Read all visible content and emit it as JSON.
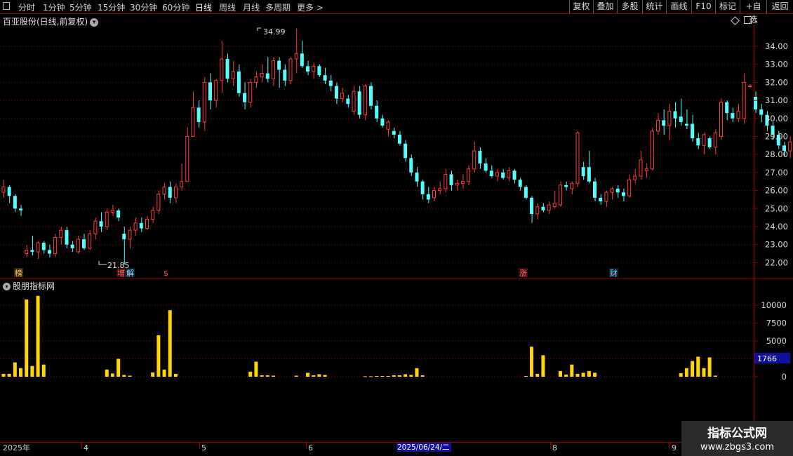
{
  "toolbar": {
    "periods": [
      "分时",
      "1分钟",
      "5分钟",
      "15分钟",
      "30分钟",
      "60分钟",
      "日线",
      "周线",
      "月线",
      "多周期",
      "更多"
    ],
    "selected": "日线",
    "right_buttons": [
      "复权",
      "叠加",
      "多股",
      "统计",
      "画线",
      "F10",
      "标记",
      "+自选",
      "返回"
    ]
  },
  "chart_title": "百亚股份(日线,前复权)",
  "indicator_title": "股朋指标网",
  "price_axis": [
    "34.00",
    "33.00",
    "32.00",
    "31.00",
    "30.00",
    "29.00",
    "28.00",
    "27.00",
    "26.00",
    "25.00",
    "24.00",
    "23.00",
    "22.00"
  ],
  "volume_axis": [
    "10000",
    "7500",
    "5000",
    "2500",
    "0"
  ],
  "volume_current": "1766",
  "high_label": "34.99",
  "low_label": "21.85",
  "events": [
    "榜",
    "增",
    "解",
    "$",
    "涨",
    "财"
  ],
  "x_axis": [
    "2025年",
    "4",
    "5",
    "6",
    "2025/06/24/二",
    "8",
    "9"
  ],
  "watermark": {
    "line1": "指标公式网",
    "line2": "www.zbgs3.com"
  },
  "colors": {
    "up": "#ff3c3c",
    "down": "#54ffff",
    "volume": "#ffd700",
    "grid": "#8a0000",
    "axis_text": "#d8d8d8"
  },
  "chart_data": {
    "type": "candlestick",
    "symbol": "百亚股份",
    "ylim": [
      21.5,
      35.3
    ],
    "volume_ylim": [
      0,
      12500
    ],
    "candles": [
      [
        25.9,
        26.6,
        25.6,
        26.2
      ],
      [
        26.2,
        26.3,
        25.3,
        25.7
      ],
      [
        25.7,
        25.8,
        24.8,
        25.0
      ],
      [
        25.0,
        25.2,
        24.6,
        24.9
      ],
      [
        22.5,
        23.0,
        22.3,
        22.7
      ],
      [
        22.7,
        23.5,
        22.4,
        22.6
      ],
      [
        22.6,
        23.2,
        22.2,
        23.1
      ],
      [
        23.1,
        23.2,
        22.5,
        22.7
      ],
      [
        22.7,
        23.0,
        22.3,
        22.5
      ],
      [
        22.5,
        23.6,
        22.3,
        23.4
      ],
      [
        23.4,
        24.0,
        23.0,
        23.8
      ],
      [
        23.8,
        24.0,
        22.8,
        23.0
      ],
      [
        23.0,
        23.2,
        22.6,
        22.8
      ],
      [
        22.6,
        23.5,
        22.5,
        23.3
      ],
      [
        23.3,
        23.6,
        22.7,
        22.8
      ],
      [
        22.8,
        23.8,
        22.7,
        23.6
      ],
      [
        23.6,
        24.5,
        23.3,
        24.3
      ],
      [
        24.3,
        24.8,
        23.7,
        24.0
      ],
      [
        24.0,
        25.0,
        23.8,
        24.8
      ],
      [
        24.8,
        25.2,
        24.6,
        24.9
      ],
      [
        24.9,
        25.0,
        24.3,
        24.5
      ],
      [
        23.6,
        24.0,
        21.9,
        23.3
      ],
      [
        23.3,
        24.0,
        22.8,
        23.8
      ],
      [
        23.8,
        24.5,
        23.5,
        24.2
      ],
      [
        24.2,
        24.5,
        23.7,
        23.9
      ],
      [
        23.9,
        24.6,
        23.8,
        24.4
      ],
      [
        24.4,
        25.1,
        24.2,
        24.9
      ],
      [
        24.9,
        26.0,
        24.7,
        25.8
      ],
      [
        25.8,
        26.4,
        25.5,
        26.2
      ],
      [
        26.2,
        26.5,
        25.3,
        25.6
      ],
      [
        25.6,
        26.4,
        25.3,
        26.2
      ],
      [
        26.2,
        27.5,
        26.0,
        26.5
      ],
      [
        26.5,
        29.5,
        26.6,
        29.0
      ],
      [
        29.0,
        31.5,
        30.0,
        30.6
      ],
      [
        30.6,
        31.0,
        29.5,
        29.8
      ],
      [
        29.8,
        32.3,
        29.3,
        32.0
      ],
      [
        32.0,
        32.5,
        30.5,
        31.0
      ],
      [
        31.0,
        32.2,
        30.6,
        32.1
      ],
      [
        32.1,
        34.3,
        31.4,
        33.3
      ],
      [
        33.3,
        33.6,
        32.0,
        32.2
      ],
      [
        32.2,
        33.2,
        31.8,
        32.6
      ],
      [
        32.6,
        33.0,
        31.2,
        31.4
      ],
      [
        31.4,
        32.0,
        30.5,
        30.9
      ],
      [
        30.9,
        32.2,
        30.6,
        32.0
      ],
      [
        32.0,
        32.6,
        31.7,
        32.3
      ],
      [
        32.3,
        33.0,
        32.0,
        32.5
      ],
      [
        32.5,
        33.4,
        32.0,
        32.2
      ],
      [
        32.2,
        33.4,
        31.8,
        33.2
      ],
      [
        33.2,
        33.4,
        31.7,
        32.7
      ],
      [
        32.7,
        33.0,
        31.8,
        32.1
      ],
      [
        32.1,
        33.4,
        31.9,
        33.3
      ],
      [
        33.3,
        34.99,
        32.5,
        33.6
      ],
      [
        33.6,
        34.3,
        32.8,
        32.9
      ],
      [
        32.9,
        33.2,
        32.4,
        32.6
      ],
      [
        32.6,
        33.1,
        32.2,
        32.9
      ],
      [
        32.9,
        33.0,
        32.3,
        32.4
      ],
      [
        32.4,
        32.8,
        31.9,
        32.1
      ],
      [
        32.1,
        32.4,
        31.5,
        31.8
      ],
      [
        31.8,
        32.0,
        30.8,
        31.1
      ],
      [
        31.1,
        31.7,
        30.9,
        31.4
      ],
      [
        31.1,
        31.3,
        30.6,
        30.8
      ],
      [
        30.4,
        31.8,
        30.2,
        31.5
      ],
      [
        31.5,
        31.8,
        30.0,
        30.2
      ],
      [
        30.2,
        31.9,
        29.9,
        31.8
      ],
      [
        31.8,
        32.0,
        30.5,
        30.7
      ],
      [
        30.7,
        31.0,
        29.8,
        30.0
      ],
      [
        30.0,
        30.2,
        29.5,
        29.6
      ],
      [
        29.4,
        29.9,
        29.0,
        29.8
      ],
      [
        29.3,
        29.5,
        28.9,
        29.1
      ],
      [
        29.1,
        29.3,
        28.5,
        28.6
      ],
      [
        28.6,
        28.8,
        27.6,
        27.8
      ],
      [
        27.8,
        28.0,
        26.8,
        27.0
      ],
      [
        27.0,
        27.3,
        26.2,
        26.5
      ],
      [
        26.5,
        26.6,
        25.5,
        25.8
      ],
      [
        25.8,
        26.2,
        25.3,
        25.5
      ],
      [
        25.6,
        26.2,
        25.4,
        26.0
      ],
      [
        26.0,
        26.5,
        25.8,
        26.1
      ],
      [
        26.1,
        27.2,
        25.9,
        26.9
      ],
      [
        26.9,
        27.1,
        26.0,
        26.3
      ],
      [
        26.3,
        26.6,
        26.0,
        26.4
      ],
      [
        26.4,
        26.9,
        26.1,
        26.5
      ],
      [
        26.5,
        27.4,
        26.3,
        27.2
      ],
      [
        27.2,
        28.7,
        27.0,
        28.2
      ],
      [
        28.2,
        28.4,
        27.2,
        27.5
      ],
      [
        27.5,
        27.8,
        27.0,
        27.1
      ],
      [
        27.1,
        27.4,
        26.7,
        26.8
      ],
      [
        26.8,
        27.2,
        26.5,
        27.0
      ],
      [
        27.0,
        27.2,
        26.6,
        26.7
      ],
      [
        26.7,
        27.3,
        26.5,
        27.1
      ],
      [
        27.1,
        27.2,
        26.4,
        26.6
      ],
      [
        26.6,
        26.7,
        26.0,
        26.2
      ],
      [
        26.2,
        26.3,
        25.5,
        25.6
      ],
      [
        25.6,
        25.7,
        24.2,
        24.7
      ],
      [
        24.7,
        25.3,
        24.4,
        25.1
      ],
      [
        25.1,
        25.3,
        24.8,
        24.9
      ],
      [
        24.9,
        25.4,
        24.7,
        25.2
      ],
      [
        25.1,
        26.0,
        25.0,
        25.3
      ],
      [
        25.2,
        26.5,
        25.1,
        26.3
      ],
      [
        26.3,
        26.5,
        26.0,
        26.2
      ],
      [
        26.1,
        26.5,
        25.8,
        26.4
      ],
      [
        26.4,
        29.3,
        26.2,
        29.2
      ],
      [
        27.3,
        27.6,
        26.6,
        26.8
      ],
      [
        27.3,
        28.2,
        26.4,
        26.5
      ],
      [
        26.5,
        26.7,
        25.4,
        25.6
      ],
      [
        25.6,
        25.8,
        25.2,
        25.4
      ],
      [
        25.4,
        26.0,
        25.1,
        25.9
      ],
      [
        25.9,
        26.2,
        25.5,
        26.1
      ],
      [
        26.1,
        26.3,
        25.6,
        25.9
      ],
      [
        25.9,
        26.1,
        25.4,
        25.7
      ],
      [
        25.7,
        26.9,
        25.6,
        26.6
      ],
      [
        26.6,
        27.2,
        26.4,
        26.8
      ],
      [
        26.8,
        28.2,
        26.6,
        27.7
      ],
      [
        27.1,
        27.5,
        26.7,
        27.2
      ],
      [
        27.2,
        29.5,
        27.1,
        29.3
      ],
      [
        29.3,
        30.3,
        29.1,
        29.9
      ],
      [
        29.9,
        30.5,
        29.1,
        29.6
      ],
      [
        29.6,
        30.8,
        28.8,
        30.4
      ],
      [
        30.4,
        30.9,
        29.5,
        30.0
      ],
      [
        30.1,
        31.1,
        29.6,
        29.8
      ],
      [
        29.7,
        30.5,
        29.4,
        29.6
      ],
      [
        29.7,
        30.2,
        28.7,
        28.9
      ],
      [
        28.9,
        29.2,
        28.3,
        28.5
      ],
      [
        28.5,
        29.2,
        28.0,
        29.1
      ],
      [
        28.9,
        29.0,
        28.3,
        28.4
      ],
      [
        28.4,
        29.4,
        28.0,
        29.2
      ],
      [
        29.0,
        31.1,
        28.8,
        30.9
      ],
      [
        30.9,
        31.0,
        29.9,
        30.3
      ],
      [
        30.3,
        30.6,
        29.8,
        30.0
      ],
      [
        30.0,
        30.8,
        29.8,
        30.4
      ],
      [
        30.0,
        32.5,
        29.7,
        32.0
      ],
      [
        31.8,
        31.9,
        31.7,
        31.8
      ],
      [
        31.2,
        31.5,
        30.3,
        30.5
      ],
      [
        30.5,
        30.8,
        29.8,
        30.2
      ],
      [
        30.2,
        30.4,
        29.3,
        29.6
      ],
      [
        29.6,
        29.8,
        28.8,
        29.1
      ],
      [
        29.1,
        29.3,
        28.3,
        28.5
      ],
      [
        28.5,
        28.7,
        27.9,
        28.2
      ],
      [
        28.2,
        29.0,
        27.8,
        28.7
      ]
    ],
    "volumes": [
      400,
      400,
      2000,
      1200,
      10800,
      1500,
      11300,
      1700,
      0,
      0,
      0,
      0,
      0,
      0,
      0,
      0,
      0,
      0,
      1000,
      450,
      2500,
      250,
      150,
      0,
      0,
      0,
      600,
      5800,
      1000,
      9300,
      400,
      0,
      0,
      0,
      0,
      0,
      0,
      0,
      0,
      0,
      0,
      0,
      0,
      700,
      2100,
      200,
      200,
      150,
      0,
      0,
      0,
      150,
      0,
      550,
      200,
      350,
      250,
      0,
      0,
      0,
      0,
      0,
      0,
      60,
      60,
      100,
      100,
      100,
      200,
      200,
      350,
      250,
      1200,
      200,
      0,
      0,
      0,
      0,
      0,
      0,
      0,
      0,
      0,
      0,
      0,
      0,
      0,
      0,
      0,
      0,
      0,
      100,
      4200,
      400,
      3000,
      0,
      0,
      800,
      300,
      1700,
      400,
      550,
      800,
      550,
      0,
      0,
      0,
      0,
      0,
      0,
      0,
      0,
      0,
      0,
      0,
      0,
      0,
      0,
      500,
      1200,
      2200,
      2800,
      1200,
      2700,
      150,
      0,
      0,
      0,
      0,
      0,
      0,
      0,
      0,
      0,
      0,
      0,
      0,
      0,
      0,
      0,
      0,
      0,
      0,
      0,
      300,
      0
    ]
  }
}
